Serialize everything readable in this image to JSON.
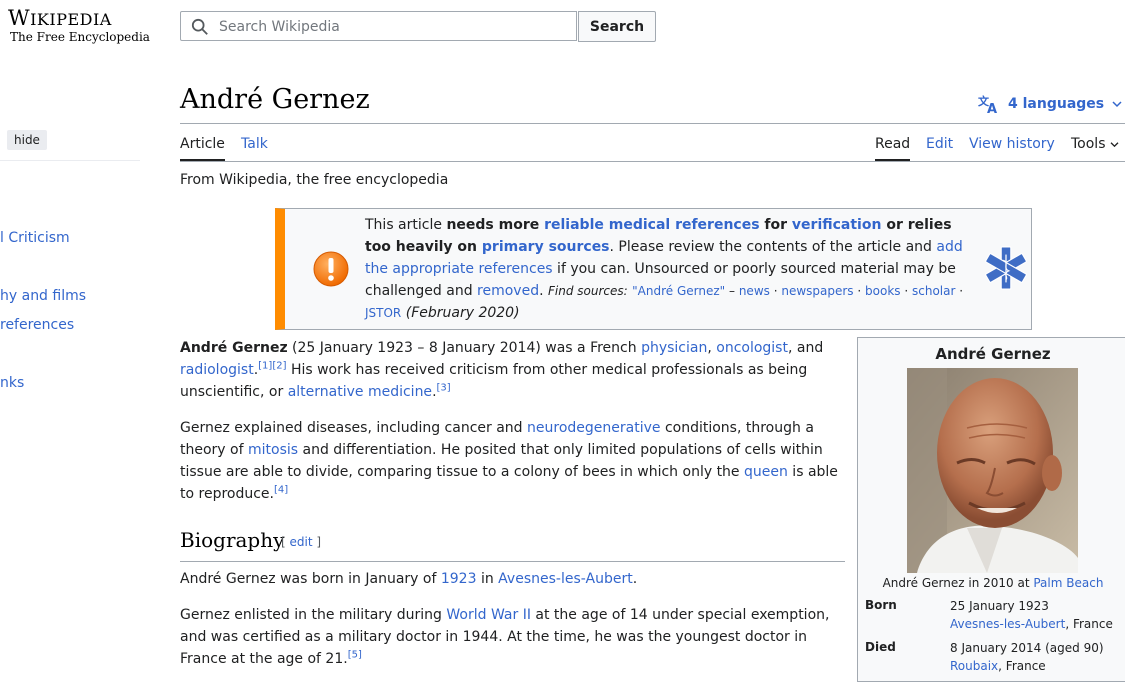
{
  "header": {
    "logo_title_w": "W",
    "logo_title_rest": "IKIPEDIA",
    "logo_title_end": "",
    "logo_tagline": "The Free Encyclopedia",
    "search_placeholder": "Search Wikipedia",
    "search_button": "Search"
  },
  "sidebar": {
    "hide_label": "hide",
    "toc_items": [
      "l Criticism",
      "hy and films",
      "references",
      "nks"
    ]
  },
  "page": {
    "title": "André Gernez",
    "languages_label": "4 languages",
    "tabs_left": [
      "Article",
      "Talk"
    ],
    "tabs_right": [
      "Read",
      "Edit",
      "View history",
      "Tools"
    ],
    "tagline": "From Wikipedia, the free encyclopedia"
  },
  "ambox": {
    "t1": "This article ",
    "t2": "needs more ",
    "t3": "reliable medical references",
    "t4": " for ",
    "t5": "verification",
    "t6": " or relies too heavily on ",
    "t7": "primary sources",
    "t8": ". Please review the contents of the article and ",
    "t9": "add the appropriate references",
    "t10": " if you can. Unsourced or poorly sourced material may be challenged and ",
    "t11": "removed",
    "t12": ".",
    "find_label": "Find sources:",
    "find_query": "\"André Gernez\"",
    "dash": " – ",
    "src1": "news",
    "src2": "newspapers",
    "src3": "books",
    "src4": "scholar",
    "src5": "JSTOR",
    "date": "(February 2020)"
  },
  "lead": {
    "name": "André Gernez",
    "p1a": " (25 January 1923 – 8 January 2014) was a French ",
    "l_physician": "physician",
    "comma": ", ",
    "l_oncologist": "oncologist",
    "and": ", and ",
    "l_radiologist": "radiologist",
    "dot": ".",
    "ref1": "[1]",
    "ref2": "[2]",
    "p1b": " His work has received criticism from other medical professionals as being unscientific, or ",
    "l_altmed": "alternative medicine",
    "ref3": "[3]"
  },
  "para2": {
    "a": "Gernez explained diseases, including cancer and ",
    "l_neuro": "neurodegenerative",
    "b": " conditions, through a theory of ",
    "l_mitosis": "mitosis",
    "c": " and differentiation. He posited that only limited populations of cells within tissue are able to divide, comparing tissue to a colony of bees in which only the ",
    "l_queen": "queen",
    "d": " is able to reproduce.",
    "ref4": "[4]"
  },
  "biography": {
    "heading": "Biography",
    "edit_open": "[ ",
    "edit": "edit",
    "edit_close": " ]",
    "p1a": "André Gernez was born in January of ",
    "l_year": "1923",
    "p1b": " in ",
    "l_place": "Avesnes-les-Aubert",
    "p1c": ".",
    "p2a": "Gernez enlisted in the military during ",
    "l_ww2": "World War II",
    "p2b": " at the age of 14 under special exemption, and was certified as a military doctor in 1944. At the time, he was the youngest doctor in France at the age of 21.",
    "ref5": "[5]"
  },
  "infobox": {
    "title": "André Gernez",
    "caption_a": "André Gernez in 2010 at ",
    "caption_link": "Palm Beach",
    "born_label": "Born",
    "born_date": "25 January 1923",
    "born_place_link": "Avesnes-les-Aubert",
    "born_place_rest": ", France",
    "died_label": "Died",
    "died_date": "8 January 2014 (aged 90)",
    "died_place_link": "Roubaix",
    "died_place_rest": ", France"
  },
  "colors": {
    "link": "#3366cc",
    "ambox_border": "#ff8c00",
    "text": "#202122"
  },
  "icons": [
    "search-icon",
    "translate-icon",
    "chevron-down-icon",
    "warning-icon",
    "star-of-life-icon"
  ]
}
